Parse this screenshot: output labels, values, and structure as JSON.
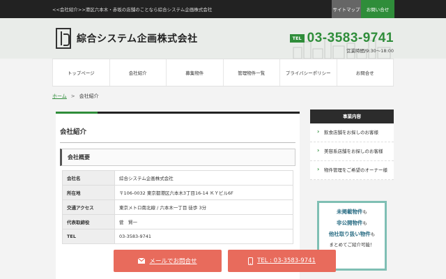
{
  "topbar": {
    "tagline": "<<会社紹介>>港区六本木・赤坂の店舗のことなら綜合システム企画株式会社",
    "sitemap": "サイトマップ",
    "contact": "お問い合せ"
  },
  "header": {
    "company": "綜合システム企画株式会社",
    "tel_badge": "TEL",
    "tel": "03-3583-9741",
    "hours": "営業時間/9:30〜18:00"
  },
  "nav": [
    "トップページ",
    "会社紹介",
    "募集物件",
    "管理物件一覧",
    "プライバシーポリシー",
    "お問合せ"
  ],
  "breadcrumb": {
    "home": "ホーム",
    "sep": ">",
    "current": "会社紹介"
  },
  "main": {
    "title": "会社紹介",
    "section": "会社概要",
    "rows": [
      {
        "k": "会社名",
        "v": "綜合システム企画株式会社"
      },
      {
        "k": "所在地",
        "v": "〒106-0032 東京都港区六本木3丁目16-14 ＫＹビル6F"
      },
      {
        "k": "交通アクセス",
        "v": "東京メトロ南北線 / 六本木一丁目 徒歩 3分"
      },
      {
        "k": "代表取締役",
        "v": "菅　賢一"
      },
      {
        "k": "TEL",
        "v": "03-3583-9741"
      }
    ]
  },
  "sidebar": {
    "title": "事業内容",
    "items": [
      "飲食店舗をお探しのお客様",
      "美容系店舗をお探しのお客様",
      "物件管理をご希望のオーナー様"
    ]
  },
  "promo": {
    "line1": "未掲載物件",
    "line2": "非公開物件",
    "line3": "他社取り扱い物件",
    "suffix": "も",
    "line4": "まとめてご紹介可能！"
  },
  "cta": {
    "mail": "メールでお問合せ",
    "tel": "TEL : 03-3583-9741"
  },
  "colors": {
    "accent": "#2f8d3a",
    "cta": "#e86b5c",
    "dark": "#222222"
  },
  "icons": {
    "mail": "mail-icon",
    "phone": "phone-icon"
  }
}
